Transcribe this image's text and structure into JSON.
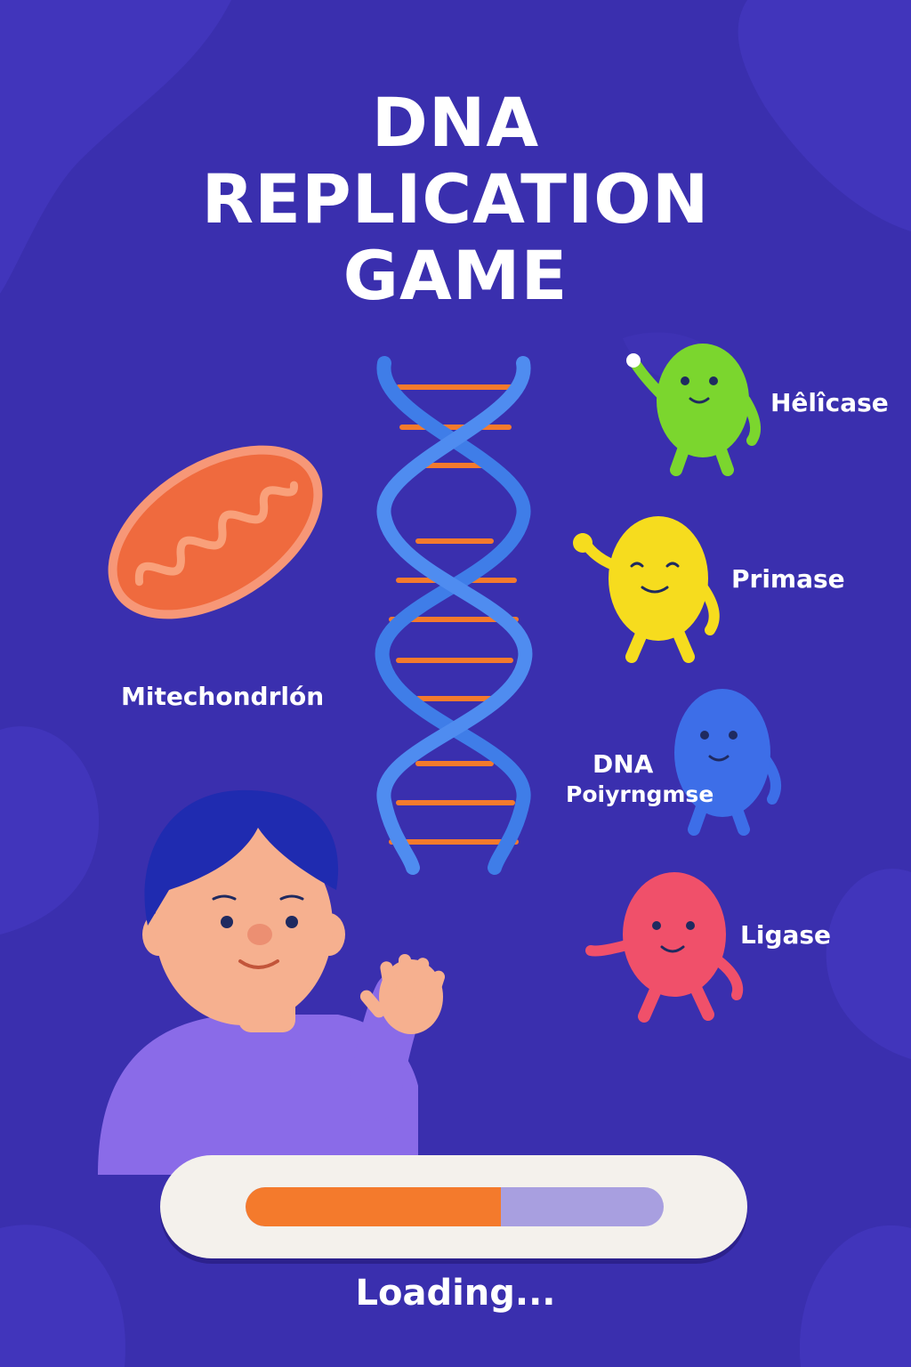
{
  "title": {
    "line1": "DNA",
    "line2": "REPLICATION",
    "line3": "GAME"
  },
  "characters": {
    "mitochondrion": "Mitechondrlón",
    "helicase": "Hêlîcase",
    "primase": "Primase",
    "polymerase_line1": "DNA",
    "polymerase_line2": "Poiyrngmse",
    "ligase": "Ligase"
  },
  "loading": {
    "text": "Loading...",
    "progress_percent": 61
  },
  "colors": {
    "background": "#3a2fae",
    "helix": "#3f7de8",
    "base_pair": "#f47a2c",
    "helicase": "#7bd62e",
    "primase": "#f6dc1e",
    "polymerase": "#3d6ee8",
    "ligase": "#f0506a",
    "mitochondrion": "#ef6a3e"
  }
}
